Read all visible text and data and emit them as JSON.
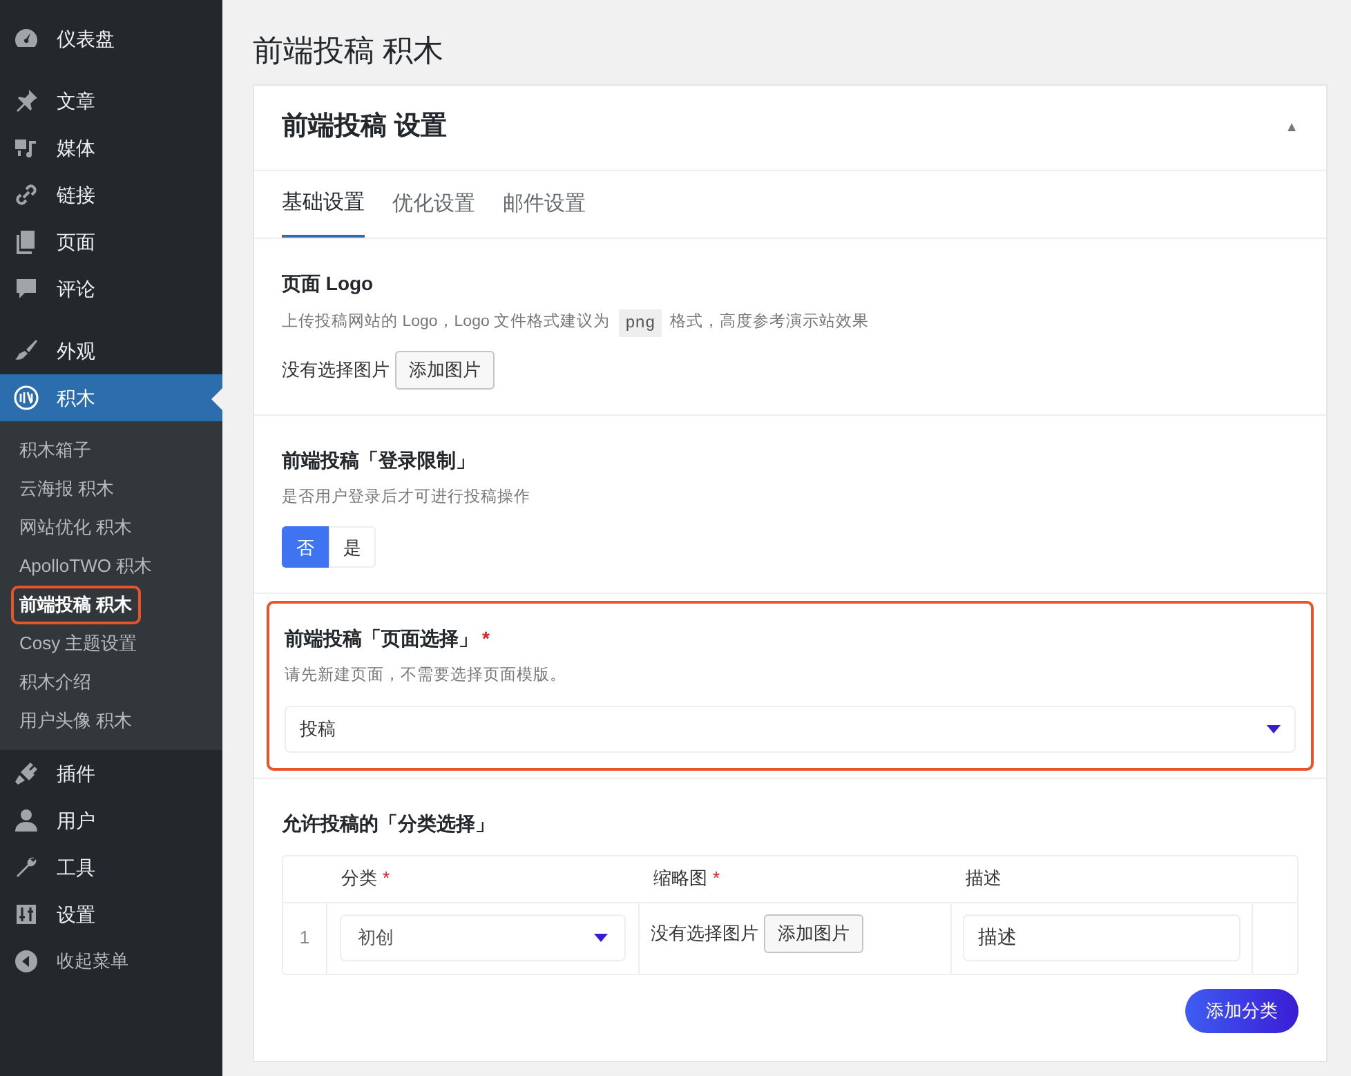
{
  "sidebar": {
    "groups": [
      [
        {
          "label": "仪表盘",
          "active": false
        }
      ],
      [
        {
          "label": "文章",
          "active": false
        },
        {
          "label": "媒体",
          "active": false
        },
        {
          "label": "链接",
          "active": false
        },
        {
          "label": "页面",
          "active": false
        },
        {
          "label": "评论",
          "active": false
        }
      ],
      [
        {
          "label": "外观",
          "active": false
        },
        {
          "label": "积木",
          "active": true,
          "children": [
            {
              "label": "积木箱子",
              "current": false,
              "highlighted": false
            },
            {
              "label": "云海报 积木",
              "current": false,
              "highlighted": false
            },
            {
              "label": "网站优化 积木",
              "current": false,
              "highlighted": false
            },
            {
              "label": "ApolloTWO 积木",
              "current": false,
              "highlighted": false
            },
            {
              "label": "前端投稿 积木",
              "current": true,
              "highlighted": true
            },
            {
              "label": "Cosy 主题设置",
              "current": false,
              "highlighted": false
            },
            {
              "label": "积木介绍",
              "current": false,
              "highlighted": false
            },
            {
              "label": "用户头像 积木",
              "current": false,
              "highlighted": false
            }
          ]
        },
        {
          "label": "插件",
          "active": false
        },
        {
          "label": "用户",
          "active": false
        },
        {
          "label": "工具",
          "active": false
        },
        {
          "label": "设置",
          "active": false
        }
      ]
    ],
    "collapse": "收起菜单"
  },
  "page_title": "前端投稿 积木",
  "panel": {
    "title": "前端投稿 设置",
    "collapse_icon": "▲",
    "tabs": [
      {
        "label": "基础设置",
        "selected": true
      },
      {
        "label": "优化设置",
        "selected": false
      },
      {
        "label": "邮件设置",
        "selected": false
      }
    ],
    "sections": [
      {
        "kind": "image",
        "title": "页面 Logo",
        "highlighted": false,
        "description": [
          "上传投稿网站的 Logo，Logo 文件格式建议为",
          "png",
          "格式，高度参考演示站效果"
        ],
        "status": "没有选择图片",
        "button": "添加图片"
      },
      {
        "kind": "toggle",
        "title": "前端投稿「登录限制」",
        "highlighted": false,
        "description": [
          "是否用户登录后才可进行投稿操作"
        ],
        "options": [
          {
            "label": "否",
            "selected": true
          },
          {
            "label": "是",
            "selected": false
          }
        ]
      },
      {
        "kind": "select",
        "title": "前端投稿「页面选择」",
        "required_mark": "*",
        "highlighted": true,
        "description": [
          "请先新建页面，不需要选择页面模版。"
        ],
        "value": "投稿"
      },
      {
        "kind": "repeater",
        "title": "允许投稿的「分类选择」",
        "highlighted": false,
        "columns": [
          {
            "label": "分类",
            "required_mark": "*"
          },
          {
            "label": "缩略图",
            "required_mark": "*"
          },
          {
            "label": "描述"
          }
        ],
        "rows": [
          {
            "index": "1",
            "category": "初创",
            "status": "没有选择图片",
            "button": "添加图片",
            "description": "描述"
          }
        ],
        "add_button": "添加分类"
      }
    ]
  }
}
